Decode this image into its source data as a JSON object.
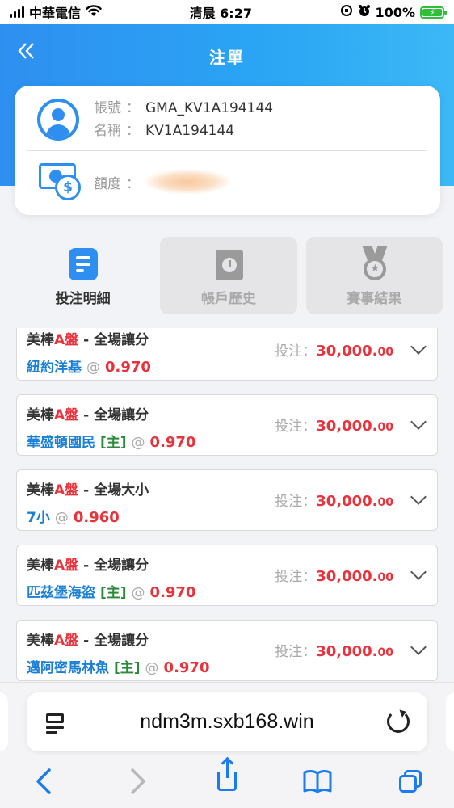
{
  "status_bar": {
    "carrier": "中華電信",
    "time": "清晨 6:27",
    "battery": "100%"
  },
  "header": {
    "title": "注單",
    "back_icon": "double-chevron-left-icon"
  },
  "account": {
    "account_label": "帳號",
    "account_value": "GMA_KV1A194144",
    "name_label": "名稱",
    "name_value": "KV1A194144",
    "credit_label": "額度",
    "separator": "："
  },
  "tabs": [
    {
      "label": "投注明細",
      "icon": "document-icon",
      "active": true
    },
    {
      "label": "帳戶歷史",
      "icon": "clock-book-icon",
      "active": false
    },
    {
      "label": "賽事結果",
      "icon": "medal-icon",
      "active": false
    }
  ],
  "bets": [
    {
      "league_prefix": "美棒",
      "league_hl": "A盤",
      "market": " - 全場讓分",
      "team": "紐約洋基",
      "home": "",
      "at": "@",
      "odds": "0.970",
      "stake_label": "投注：",
      "stake": "30,000.",
      "stake_dec": "00"
    },
    {
      "league_prefix": "美棒",
      "league_hl": "A盤",
      "market": " - 全場讓分",
      "team": "華盛頓國民",
      "home": "[主]",
      "at": "@",
      "odds": "0.970",
      "stake_label": "投注：",
      "stake": "30,000.",
      "stake_dec": "00"
    },
    {
      "league_prefix": "美棒",
      "league_hl": "A盤",
      "market": " - 全場大小",
      "team": "7小",
      "home": "",
      "at": "@",
      "odds": "0.960",
      "stake_label": "投注：",
      "stake": "30,000.",
      "stake_dec": "00"
    },
    {
      "league_prefix": "美棒",
      "league_hl": "A盤",
      "market": " - 全場讓分",
      "team": "匹茲堡海盜",
      "home": "[主]",
      "at": "@",
      "odds": "0.970",
      "stake_label": "投注：",
      "stake": "30,000.",
      "stake_dec": "00"
    },
    {
      "league_prefix": "美棒",
      "league_hl": "A盤",
      "market": " - 全場讓分",
      "team": "邁阿密馬林魚",
      "home": "[主]",
      "at": "@",
      "odds": "0.970",
      "stake_label": "投注：",
      "stake": "30,000.",
      "stake_dec": "00"
    }
  ],
  "browser": {
    "url": "ndm3m.sxb168.win"
  },
  "colors": {
    "brand_blue": "#2e8ff0",
    "odds_red": "#e8323c",
    "team_blue": "#1a7fd6",
    "home_green": "#2a8a3a"
  }
}
